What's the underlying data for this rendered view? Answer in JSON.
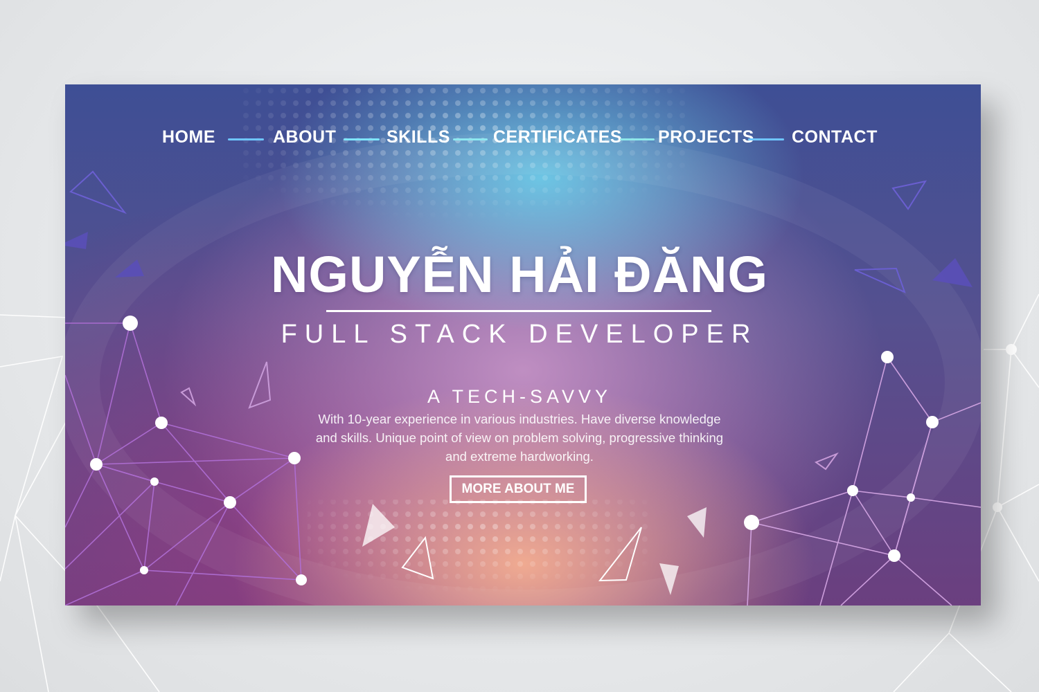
{
  "nav": {
    "items": [
      "HOME",
      "ABOUT",
      "SKILLS",
      "CERTIFICATES",
      "PROJECTS",
      "CONTACT"
    ],
    "line_colors": [
      "#6fc6ff",
      "#7fe6ff",
      "#8de8f0",
      "#8ee8ea",
      "#6fc6ff"
    ]
  },
  "hero": {
    "name": "NGUYỄN HẢI ĐĂNG",
    "role": "FULL STACK DEVELOPER",
    "tagline": "A TECH-SAVVY",
    "description": "With 10-year experience in various industries. Have diverse knowledge and skills. Unique point of view on problem solving, progressive thinking and extreme hardworking.",
    "button_label": "MORE ABOUT ME"
  },
  "colors": {
    "text": "#ffffff",
    "banner_top": "#3e4f95",
    "banner_bottom": "#6b3f7f",
    "accent_cyan": "#6ed7f0",
    "accent_peach": "#f5af91",
    "triangle_violet": "#5a4fb8"
  }
}
